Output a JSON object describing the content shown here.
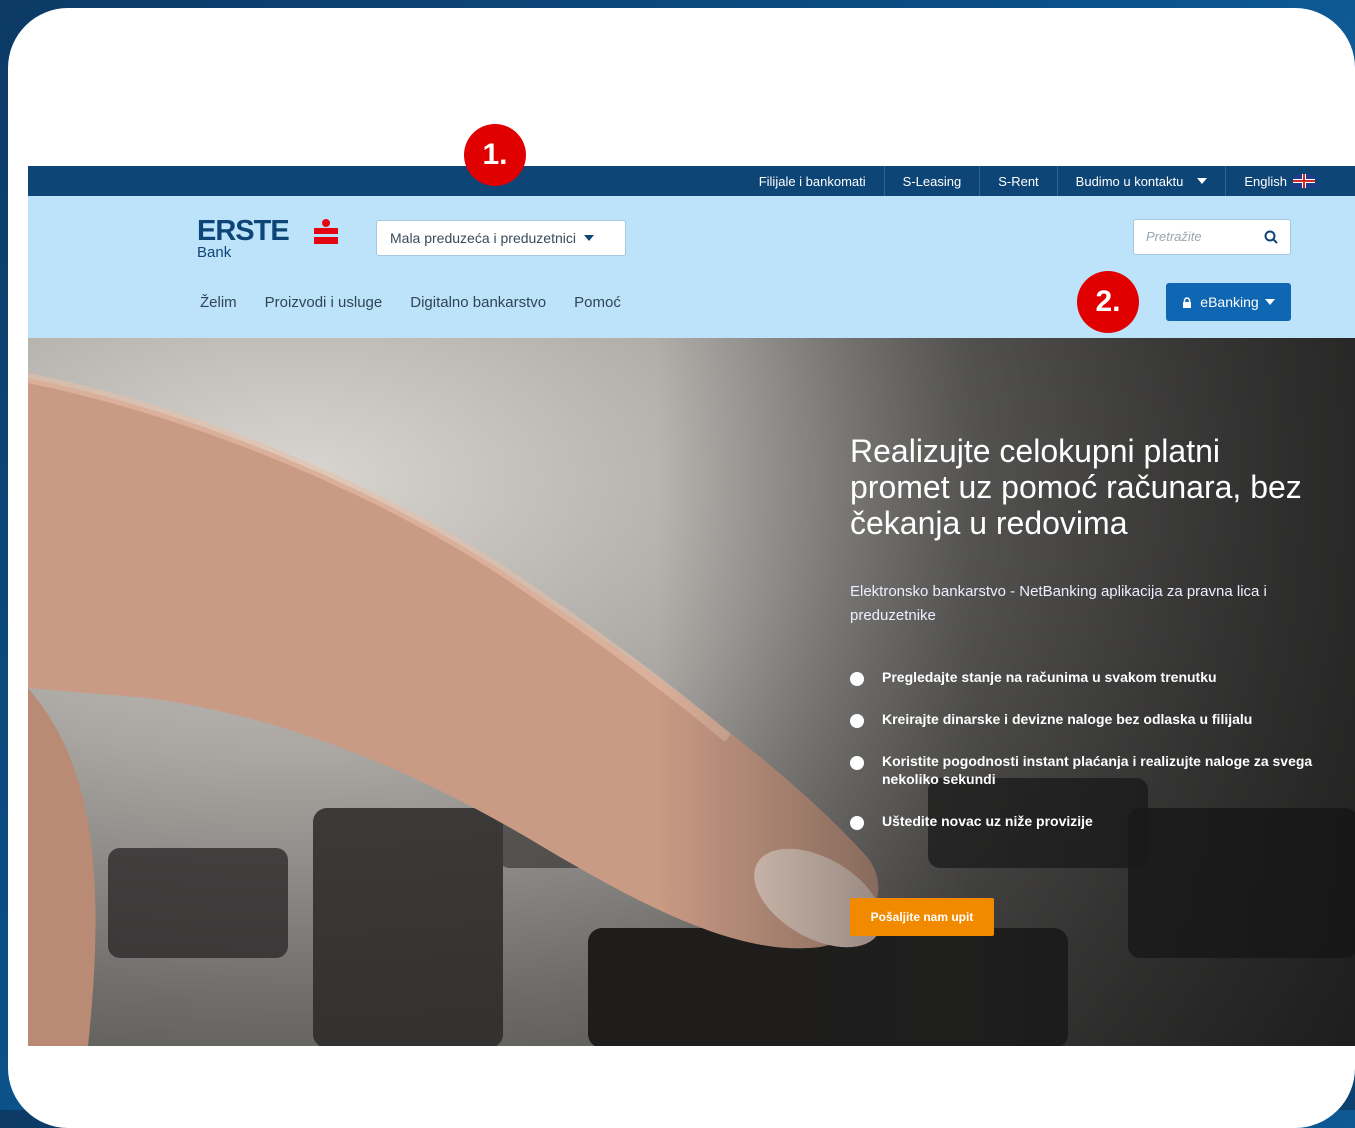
{
  "markers": {
    "m1": "1.",
    "m2": "2."
  },
  "topbar": {
    "links": [
      "Filijale i bankomati",
      "S-Leasing",
      "S-Rent",
      "Budimo u kontaktu",
      "English"
    ]
  },
  "header": {
    "logo_text": "ERSTE",
    "logo_sub": "Bank",
    "segment_label": "Mala preduzeća i preduzetnici",
    "search_placeholder": "Pretražite",
    "nav": [
      "Želim",
      "Proizvodi i usluge",
      "Digitalno bankarstvo",
      "Pomoć"
    ],
    "ebanking_label": "eBanking"
  },
  "hero": {
    "headline": "Realizujte celokupni platni promet uz pomoć računara, bez čekanja u redovima",
    "subtitle": "Elektronsko bankarstvo - NetBanking aplikacija za pravna lica i preduzetnike",
    "bullets": [
      "Pregledajte stanje na računima u svakom trenutku",
      "Kreirajte dinarske i devizne naloge bez odlaska u filijalu",
      "Koristite pogodnosti instant plaćanja i realizujte naloge za svega nekoliko sekundi",
      "Uštedite novac uz niže provizije"
    ],
    "cta_label": "Pošaljite nam upit"
  },
  "colors": {
    "topbar": "#0d4576",
    "header": "#bde3fb",
    "accent": "#0f66b2",
    "cta": "#f28a00",
    "marker": "#e00000",
    "logo_red": "#e30613"
  }
}
